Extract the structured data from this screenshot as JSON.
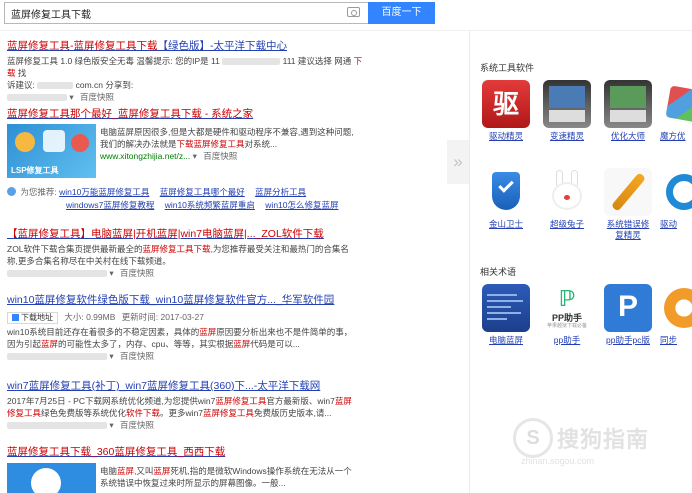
{
  "search": {
    "query": "蓝屏修复工具下载",
    "button": "百度一下"
  },
  "results": [
    {
      "title_pre": "蓝屏修复工具",
      "title_mid": "-蓝屏修复工具下载",
      "title_post": "【绿色版】-太平洋下载中心",
      "abs1": "蓝屏修复工具 1.0 绿色版安全无毒 温馨提示: 您的IP是 11",
      "abs1_mid": "111 建议选择 网通",
      "abs1_red": "下载",
      "abs1_end": "找",
      "abs2": "诉建议:",
      "abs2_url": "com.cn 分享到:",
      "snapshot": "百度快照"
    },
    {
      "title": "蓝屏修复工具那个最好_蓝屏修复工具下载 - 系统之家",
      "abs1": "电脑蓝屏原因很多,但是大都是硬件和驱动程序不兼容,遇到这种问题,",
      "abs2": "我们的解决办法就是",
      "abs2_red": "下载蓝屏修复工具",
      "abs2_end": "对系统...",
      "url": "www.xitongzhijia.net/z...",
      "snapshot": "百度快照",
      "thumb_caption": "LSP修复工具"
    }
  ],
  "recommend": {
    "label": "为您推荐:",
    "links_row1": [
      "win10万能蓝屏修复工具",
      "蓝屏修复工具哪个最好",
      "蓝屏分析工具"
    ],
    "links_row2": [
      "windows7蓝屏修复教程",
      "win10系统频繁蓝屏重启",
      "win10怎么修复蓝屏"
    ]
  },
  "result3": {
    "title": "【蓝屏修复工具】电脑蓝屏|开机蓝屏|win7电脑蓝屏|..._ZOL软件下载",
    "abs1": "ZOL软件下载合集页提供最新最全的",
    "abs1_red": "蓝屏修复工具下载",
    "abs1_end": ",为您推荐最受关注和最热门的合集名",
    "abs2": "称,更多合集名称尽在中关村在线下载频道。",
    "snapshot": "百度快照"
  },
  "result4": {
    "title": "win10蓝屏修复软件绿色版下载_win10蓝屏修复软件官方..._华军软件园",
    "download": "下载地址",
    "size": "大小: 0.99MB",
    "updated": "更新时间: 2017-03-27",
    "abs1": "win10系统目前还存在着很多的不稳定因素，具体的",
    "abs1_red": "蓝屏",
    "abs1_end": "原因要分析出来也不是件简单的事，",
    "abs2": "因为引起",
    "abs2_red": "蓝屏",
    "abs2_mid": "的可能性太多了，内存、cpu、等等，其实根据",
    "abs2_red2": "蓝屏",
    "abs2_end": "代码是可以...",
    "snapshot": "百度快照"
  },
  "result5": {
    "title": "win7蓝屏修复工具(补丁)_win7蓝屏修复工具(360)下...-太平洋下载网",
    "abs1": "2017年7月25日 - PC下载网系统优化频道,为您提供win7",
    "abs1_red": "蓝屏修复工具",
    "abs1_mid": "官方最新版、win7",
    "abs1_red2": "蓝屏",
    "abs2_red": "修复工具",
    "abs2": "绿色免费版等系统优化",
    "abs2_red2": "软件下载",
    "abs2_mid": "。更多win7",
    "abs2_red3": "蓝屏修复工具",
    "abs2_end": "免费版历史版本,请...",
    "snapshot": "百度快照"
  },
  "result6": {
    "title": "蓝屏修复工具下载_360蓝屏修复工具_西西下载",
    "abs1": "电脑",
    "abs1_red": "蓝屏",
    "abs1_mid": ",又叫",
    "abs1_red2": "蓝屏",
    "abs1_end": "死机,指的是微软Windows操作系统在无法从一个",
    "abs2": "系统错误中恢复过来时所显示的屏幕图像。一般..."
  },
  "sidebar": {
    "collapse_glyph": "»",
    "software_title": "系统工具软件",
    "software": [
      {
        "label": "驱动精灵",
        "icon": "driver-genius-icon",
        "glyph": "驱"
      },
      {
        "label": "变速精灵",
        "icon": "speed-genius-icon"
      },
      {
        "label": "优化大师",
        "icon": "optimizer-master-icon"
      },
      {
        "label": "魔方优",
        "icon": "rubik-optimizer-icon"
      },
      {
        "label": "金山卫士",
        "icon": "kingsoft-guard-icon"
      },
      {
        "label": "超级兔子",
        "icon": "super-rabbit-icon"
      },
      {
        "label": "系统错误修复精灵",
        "label1": "系统错误修",
        "label2": "复精灵",
        "icon": "wrench-icon"
      },
      {
        "label": "驱动",
        "icon": "gear-icon"
      }
    ],
    "related_title": "相关术语",
    "related": [
      {
        "label": "电脑蓝屏",
        "icon": "blue-screen-icon"
      },
      {
        "label": "pp助手",
        "icon": "pp-assistant-icon",
        "big": "PP助手",
        "small": "苹果越狱下载必备"
      },
      {
        "label": "pp助手pc版",
        "icon": "pp-pc-icon",
        "glyph": "P"
      },
      {
        "label": "同步",
        "icon": "sync-icon"
      }
    ]
  },
  "watermark": {
    "glyph": "S",
    "text": "搜狗指南",
    "url": "zhinan.sogou.com"
  },
  "colors": {
    "link": "#2440b3",
    "highlight": "#c00",
    "url_green": "#008000",
    "search_button": "#3385ff"
  }
}
